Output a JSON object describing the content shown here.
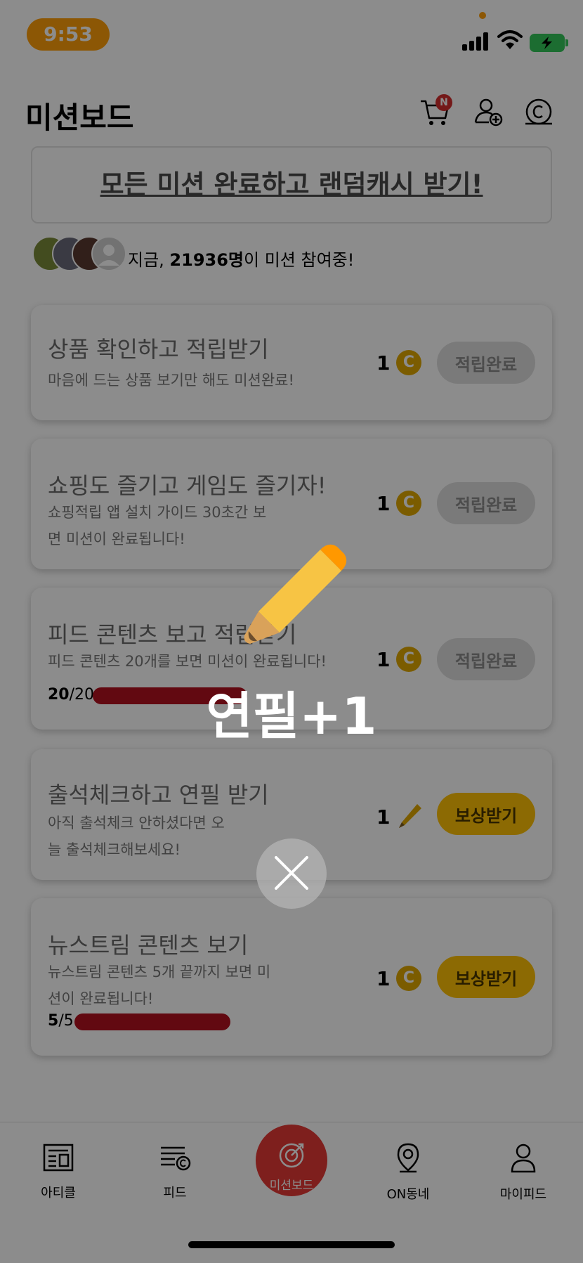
{
  "status": {
    "time": "9:53"
  },
  "header": {
    "title": "미션보드",
    "cart_badge": "N"
  },
  "banner": {
    "text": "모든 미션 완료하고 랜덤캐시 받기!"
  },
  "participants": {
    "prefix": "지금, ",
    "count": "21936명",
    "suffix": "이 미션 참여중!"
  },
  "missions": [
    {
      "title": "상품 확인하고 적립받기",
      "desc": "마음에 드는 상품 보기만 해도 미션완료!",
      "reward": "1",
      "reward_icon": "coin-icon",
      "button": "적립완료",
      "state": "done"
    },
    {
      "title": "쇼핑도 즐기고 게임도 즐기자!",
      "desc": "쇼핑적립 앱 설치 가이드 30초간 보면 미션이 완료됩니다!",
      "reward": "1",
      "reward_icon": "coin-icon",
      "button": "적립완료",
      "state": "done"
    },
    {
      "title": "피드 콘텐츠 보고 적립받기",
      "desc": "피드 콘텐츠 20개를 보면 미션이 완료됩니다!",
      "reward": "1",
      "reward_icon": "coin-icon",
      "button": "적립완료",
      "state": "done",
      "progress_done": "20",
      "progress_total": "/20",
      "progress_fraction": 1.0
    },
    {
      "title": "출석체크하고 연필 받기",
      "desc": "아직 출석체크 안하셨다면 오늘 출석체크해보세요!",
      "reward": "1",
      "reward_icon": "pencil-icon",
      "button": "보상받기",
      "state": "claim"
    },
    {
      "title": "뉴스트림 콘텐츠 보기",
      "desc": "뉴스트림 콘텐츠 5개 끝까지 보면 미션이 완료됩니다!",
      "reward": "1",
      "reward_icon": "coin-icon",
      "button": "보상받기",
      "state": "claim",
      "progress_done": "5",
      "progress_total": "/5",
      "progress_fraction": 1.0
    }
  ],
  "nav": {
    "article": "아티클",
    "feed": "피드",
    "mission": "미션보드",
    "local": "ON동네",
    "my": "마이피드"
  },
  "overlay": {
    "message": "연필+1"
  },
  "colors": {
    "accent": "#e53935",
    "claim": "#ffc107",
    "coin": "#e0a800",
    "progress": "#b3121f",
    "status_time": "#ff9f0a"
  }
}
